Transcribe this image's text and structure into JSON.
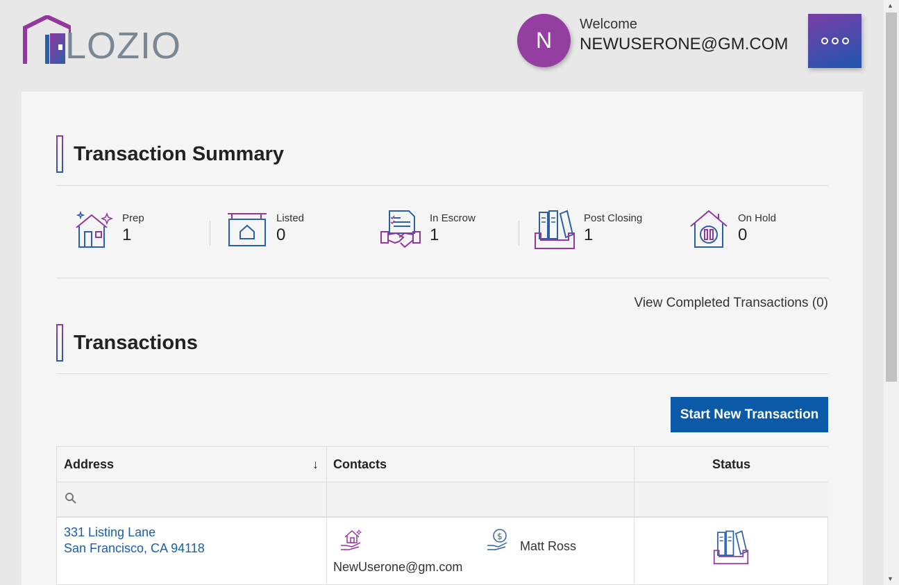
{
  "header": {
    "logo_text": "LOZIO",
    "avatar_initial": "N",
    "welcome_label": "Welcome",
    "username": "NEWUSERONE@GM.COM"
  },
  "summary": {
    "title": "Transaction Summary",
    "stats": [
      {
        "label": "Prep",
        "value": "1",
        "icon": "house-sparkle-icon"
      },
      {
        "label": "Listed",
        "value": "0",
        "icon": "hanging-sign-icon"
      },
      {
        "label": "In Escrow",
        "value": "1",
        "icon": "handshake-document-icon"
      },
      {
        "label": "Post Closing",
        "value": "1",
        "icon": "binders-tray-icon"
      },
      {
        "label": "On Hold",
        "value": "0",
        "icon": "house-pause-icon"
      }
    ],
    "view_completed": "View Completed Transactions (0)"
  },
  "transactions": {
    "title": "Transactions",
    "start_button": "Start New Transaction",
    "columns": {
      "address": "Address",
      "contacts": "Contacts",
      "status": "Status"
    },
    "sort_indicator": "↓",
    "rows": [
      {
        "address_line1": "331 Listing Lane",
        "address_line2": "San Francisco, CA 94118",
        "seller_contact": "NewUserone@gm.com",
        "buyer_agent": "Matt Ross",
        "status_icon": "binders-tray-icon"
      }
    ]
  },
  "colors": {
    "purple": "#933ea0",
    "blue": "#0b5aa8",
    "link": "#1a5ea8"
  }
}
